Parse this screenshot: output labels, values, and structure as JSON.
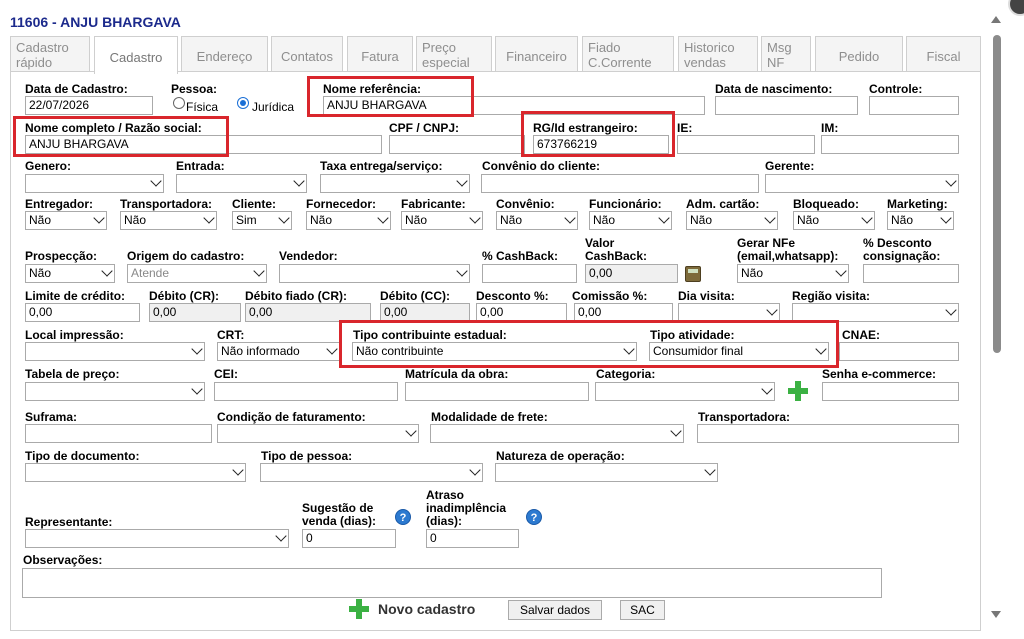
{
  "header": {
    "title": "11606 - ANJU BHARGAVA"
  },
  "tabs": [
    {
      "l1": "Cadastro",
      "l2": "rápido"
    },
    {
      "l1": "Cadastro",
      "l2": ""
    },
    {
      "l1": "Endereço",
      "l2": ""
    },
    {
      "l1": "Contatos",
      "l2": ""
    },
    {
      "l1": "Fatura",
      "l2": ""
    },
    {
      "l1": "Preço",
      "l2": "especial"
    },
    {
      "l1": "Financeiro",
      "l2": ""
    },
    {
      "l1": "Fiado",
      "l2": "C.Corrente"
    },
    {
      "l1": "Historico",
      "l2": "vendas"
    },
    {
      "l1": "Msg",
      "l2": "NF"
    },
    {
      "l1": "Pedido",
      "l2": ""
    },
    {
      "l1": "Fiscal",
      "l2": ""
    }
  ],
  "labels": {
    "data_cadastro": "Data de Cadastro:",
    "pessoa": "Pessoa:",
    "nome_referencia": "Nome referência:",
    "data_nascimento": "Data de nascimento:",
    "controle": "Controle:",
    "nome_completo": "Nome completo / Razão social:",
    "cpf_cnpj": "CPF / CNPJ:",
    "rg": "RG/Id estrangeiro:",
    "ie": "IE:",
    "im": "IM:",
    "genero": "Genero:",
    "entrada": "Entrada:",
    "taxa_entrega": "Taxa entrega/serviço:",
    "convenio_cliente": "Convênio do cliente:",
    "gerente": "Gerente:",
    "entregador": "Entregador:",
    "transportadora": "Transportadora:",
    "cliente": "Cliente:",
    "fornecedor": "Fornecedor:",
    "fabricante": "Fabricante:",
    "convenio": "Convênio:",
    "funcionario": "Funcionário:",
    "adm_cartao": "Adm. cartão:",
    "bloqueado": "Bloqueado:",
    "marketing": "Marketing:",
    "prospeccao": "Prospecção:",
    "origem_cadastro": "Origem do cadastro:",
    "vendedor": "Vendedor:",
    "cashback_pct": "% CashBack:",
    "valor_cashback_1": "Valor",
    "valor_cashback_2": "CashBack:",
    "gerar_nfe_1": "Gerar NFe",
    "gerar_nfe_2": "(email,whatsapp):",
    "desconto_consig_1": "% Desconto",
    "desconto_consig_2": "consignação:",
    "limite_credito": "Limite de crédito:",
    "debito_cr": "Débito (CR):",
    "debito_fiado": "Débito fiado (CR):",
    "debito_cc": "Débito (CC):",
    "desconto_pct": "Desconto %:",
    "comissao_pct": "Comissão %:",
    "dia_visita": "Dia visita:",
    "regiao_visita": "Região visita:",
    "local_impressao": "Local impressão:",
    "crt": "CRT:",
    "tipo_contribuinte": "Tipo contribuinte estadual:",
    "tipo_atividade": "Tipo atividade:",
    "cnae": "CNAE:",
    "tabela_preco": "Tabela de preço:",
    "cei": "CEI:",
    "matricula_obra": "Matrícula da obra:",
    "categoria": "Categoria:",
    "senha_ecommerce": "Senha e-commerce:",
    "suframa": "Suframa:",
    "condicao_faturamento": "Condição de faturamento:",
    "modalidade_frete": "Modalidade de frete:",
    "transportadora2": "Transportadora:",
    "tipo_documento": "Tipo de documento:",
    "tipo_pessoa": "Tipo de pessoa:",
    "natureza_operacao": "Natureza de operação:",
    "representante": "Representante:",
    "sugestao_1": "Sugestão de",
    "sugestao_2": "venda (dias):",
    "atraso_1": "Atraso",
    "atraso_2": "inadimplência",
    "atraso_3": "(dias):",
    "observacoes": "Observações:"
  },
  "values": {
    "data_cadastro": "22/07/2026",
    "pessoa_fisica": "Física",
    "pessoa_juridica": "Jurídica",
    "nome_referencia": "ANJU BHARGAVA",
    "nome_completo": "ANJU BHARGAVA",
    "rg": "673766219",
    "nao": "Não",
    "sim": "Sim",
    "origem": "Atende",
    "zero": "0,00",
    "crt": "Não informado",
    "tipo_contribuinte": "Não contribuinte",
    "tipo_atividade": "Consumidor final",
    "sugestao": "0",
    "atraso": "0"
  },
  "buttons": {
    "novo": "Novo cadastro",
    "salvar": "Salvar dados",
    "sac": "SAC"
  },
  "icons": {
    "help": "?"
  }
}
